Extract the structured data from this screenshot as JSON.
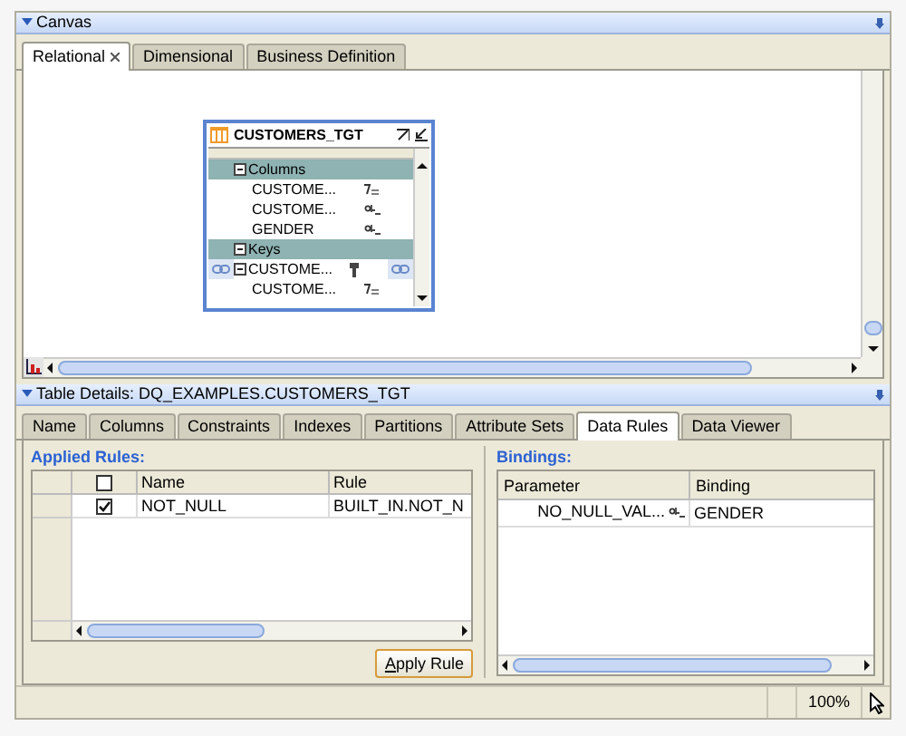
{
  "canvas_panel": {
    "title": "Canvas",
    "tabs": [
      {
        "label": "Relational",
        "selected": true,
        "closable": true
      },
      {
        "label": "Dimensional",
        "selected": false,
        "closable": false
      },
      {
        "label": "Business Definition",
        "selected": false,
        "closable": false
      }
    ]
  },
  "table_node": {
    "title": "CUSTOMERS_TGT",
    "groups": [
      {
        "label": "Columns",
        "expanded": true,
        "items": [
          {
            "name": "CUSTOME...",
            "kind": "number"
          },
          {
            "name": "CUSTOME...",
            "kind": "text"
          },
          {
            "name": "GENDER",
            "kind": "text"
          }
        ]
      },
      {
        "label": "Keys",
        "expanded": true,
        "items": [
          {
            "name": "CUSTOME...",
            "kind": "key",
            "expanded": true,
            "children": [
              {
                "name": "CUSTOME...",
                "kind": "number"
              }
            ]
          }
        ]
      }
    ]
  },
  "details_panel": {
    "title": "Table Details: DQ_EXAMPLES.CUSTOMERS_TGT",
    "tabs": [
      {
        "label": "Name",
        "selected": false
      },
      {
        "label": "Columns",
        "selected": false
      },
      {
        "label": "Constraints",
        "selected": false
      },
      {
        "label": "Indexes",
        "selected": false
      },
      {
        "label": "Partitions",
        "selected": false
      },
      {
        "label": "Attribute Sets",
        "selected": false
      },
      {
        "label": "Data Rules",
        "selected": true
      },
      {
        "label": "Data Viewer",
        "selected": false
      }
    ],
    "applied_rules": {
      "heading": "Applied Rules:",
      "header_checked": false,
      "columns": [
        "Name",
        "Rule"
      ],
      "rows": [
        {
          "checked": true,
          "name": "NOT_NULL",
          "rule": "BUILT_IN.NOT_N"
        }
      ],
      "button": "Apply Rule"
    },
    "bindings": {
      "heading": "Bindings:",
      "columns": [
        "Parameter",
        "Binding"
      ],
      "rows": [
        {
          "parameter": "NO_NULL_VAL...",
          "kind": "text",
          "binding": "GENDER"
        }
      ]
    }
  },
  "status_bar": {
    "zoom": "100%"
  }
}
